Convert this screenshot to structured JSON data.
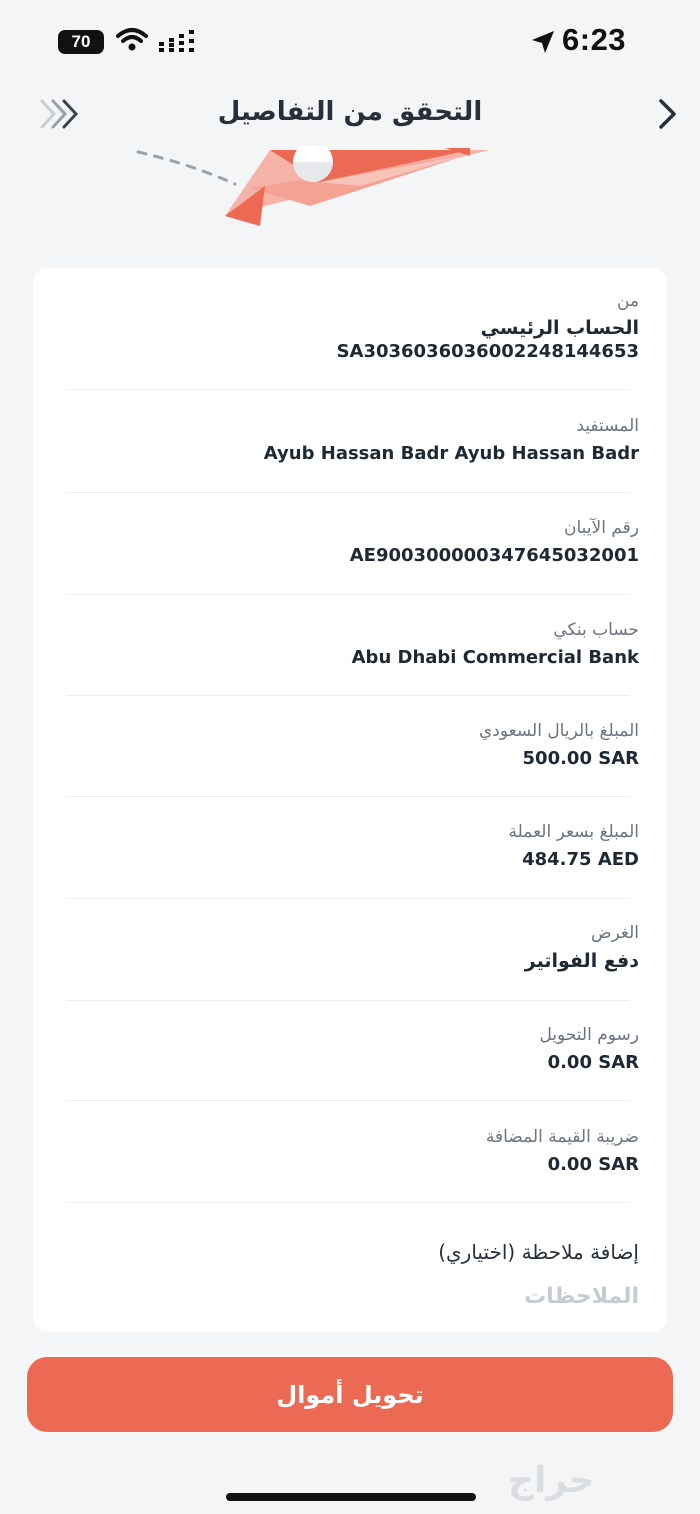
{
  "status": {
    "battery": "70",
    "time": "6:23"
  },
  "header": {
    "title": "التحقق من التفاصيل"
  },
  "fields": {
    "from": {
      "label": "من",
      "value": "الحساب الرئيسي",
      "subvalue": "SA3036036036002248144653"
    },
    "beneficiary": {
      "label": "المستفيد",
      "value": "Ayub Hassan Badr Ayub Hassan Badr"
    },
    "iban": {
      "label": "رقم الآيبان",
      "value": "AE900300000347645032001"
    },
    "bank": {
      "label": "حساب بنكي",
      "value": "Abu Dhabi Commercial Bank"
    },
    "amount_sar": {
      "label": "المبلغ بالريال السعودي",
      "value": "500.00 SAR"
    },
    "amount_fx": {
      "label": "المبلغ بسعر العملة",
      "value": "484.75 AED"
    },
    "purpose": {
      "label": "الغرض",
      "value": "دفع الفواتير"
    },
    "fees": {
      "label": "رسوم التحويل",
      "value": "0.00 SAR"
    },
    "vat": {
      "label": "ضريبة القيمة المضافة",
      "value": "0.00 SAR"
    }
  },
  "note": {
    "label": "إضافة ملاحظة (اختياري)",
    "placeholder": "الملاحظات"
  },
  "actions": {
    "transfer_label": "تحويل أموال"
  },
  "watermark": "حراج",
  "colors": {
    "accent": "#ec6a53",
    "background": "#f4f5f7",
    "card": "#ffffff"
  }
}
